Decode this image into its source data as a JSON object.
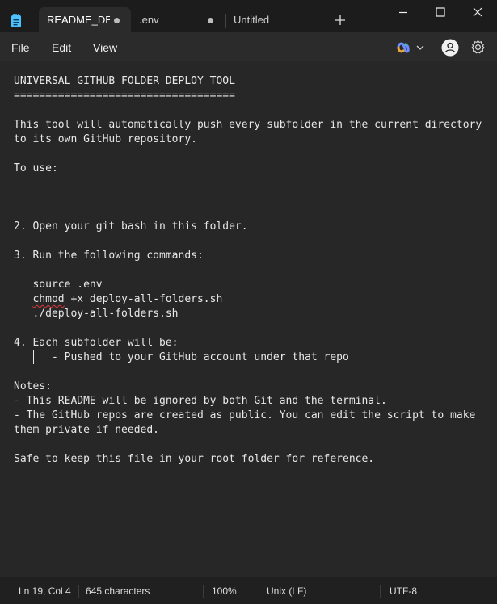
{
  "tabs": [
    {
      "label": "README_DEI",
      "active": true,
      "modified": true
    },
    {
      "label": ".env",
      "active": false,
      "modified": true
    },
    {
      "label": "Untitled",
      "active": false,
      "modified": false
    }
  ],
  "menu": {
    "file": "File",
    "edit": "Edit",
    "view": "View"
  },
  "editor": {
    "lines": [
      "UNIVERSAL GITHUB FOLDER DEPLOY TOOL",
      "===================================",
      "",
      "This tool will automatically push every subfolder in the current directory",
      "to its own GitHub repository.",
      "",
      "To use:",
      "",
      "",
      "",
      "2. Open your git bash in this folder.",
      "",
      "3. Run the following commands:",
      "",
      "   source .env",
      "   chmod +x deploy-all-folders.sh",
      "   ./deploy-all-folders.sh",
      "",
      "4. Each subfolder will be:",
      "      - Pushed to your GitHub account under that repo",
      "",
      "Notes:",
      "- This README will be ignored by both Git and the terminal.",
      "- The GitHub repos are created as public. You can edit the script to make",
      "them private if needed.",
      "",
      "Safe to keep this file in your root folder for reference."
    ],
    "misspelled_word": "chmod",
    "chmod_rest": " +x deploy-all-folders.sh",
    "chmod_indent": "   "
  },
  "status": {
    "position": "Ln 19, Col 4",
    "characters": "645 characters",
    "zoom": "100%",
    "line_ending": "Unix (LF)",
    "encoding": "UTF-8"
  },
  "colors": {
    "accent": "#4cc2ff",
    "background": "#272727",
    "spell_error": "#e03a3a"
  }
}
